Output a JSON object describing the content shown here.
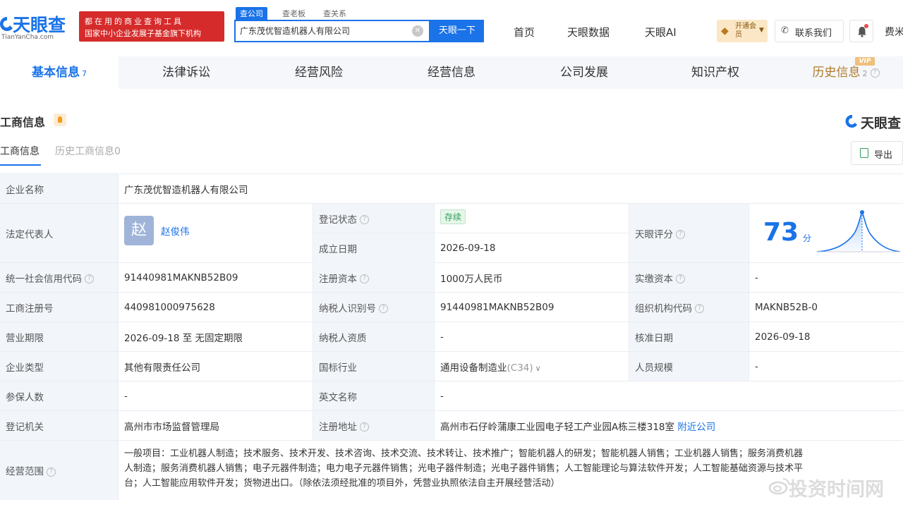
{
  "header": {
    "logo_text": "天眼查",
    "logo_sub": "TianYanCha.com",
    "promo_line1": "都在用的商业查询工具",
    "promo_line2": "国家中小企业发展子基金旗下机构",
    "search_tabs": [
      "查公司",
      "查老板",
      "查关系"
    ],
    "search_value": "广东茂优智造机器人有限公司",
    "search_button": "天眼一下",
    "nav": [
      "首页",
      "天眼数据",
      "天眼AI"
    ],
    "vip_label": "开通会员",
    "contact_label": "联系我们",
    "fee_label": "费米"
  },
  "module_tabs": [
    {
      "label": "基本信息",
      "count": "7",
      "active": true
    },
    {
      "label": "法律诉讼",
      "count": "",
      "active": false
    },
    {
      "label": "经营风险",
      "count": "",
      "active": false
    },
    {
      "label": "经营信息",
      "count": "",
      "active": false
    },
    {
      "label": "公司发展",
      "count": "",
      "active": false
    },
    {
      "label": "知识产权",
      "count": "",
      "active": false
    },
    {
      "label": "历史信息",
      "count": "2",
      "active": false
    }
  ],
  "vip_tag": "VIP",
  "section": {
    "title": "工商信息",
    "brand": "天眼查",
    "sub_tabs": [
      "工商信息",
      "历史工商信息0"
    ],
    "export_label": "导出"
  },
  "company": {
    "name_label": "企业名称",
    "name": "广东茂优智造机器人有限公司",
    "legal_rep_label": "法定代表人",
    "legal_rep_avatar": "赵",
    "legal_rep": "赵俊伟",
    "reg_status_label": "登记状态",
    "reg_status": "存续",
    "est_date_label": "成立日期",
    "est_date": "2026-09-18",
    "score_label": "天眼评分",
    "score": "73",
    "score_unit": "分",
    "credit_code_label": "统一社会信用代码",
    "credit_code": "91440981MAKNB52B09",
    "reg_capital_label": "注册资本",
    "reg_capital": "1000万人民币",
    "paid_capital_label": "实缴资本",
    "paid_capital": "-",
    "reg_no_label": "工商注册号",
    "reg_no": "440981000975628",
    "taxpayer_id_label": "纳税人识别号",
    "taxpayer_id": "91440981MAKNB52B09",
    "org_code_label": "组织机构代码",
    "org_code": "MAKNB52B-0",
    "term_label": "营业期限",
    "term": "2026-09-18 至 无固定期限",
    "taxpayer_qual_label": "纳税人资质",
    "taxpayer_qual": "-",
    "approval_date_label": "核准日期",
    "approval_date": "2026-09-18",
    "type_label": "企业类型",
    "type": "其他有限责任公司",
    "industry_label": "国标行业",
    "industry": "通用设备制造业",
    "industry_code": "(C34)",
    "staff_label": "人员规模",
    "staff": "-",
    "insured_label": "参保人数",
    "insured": "-",
    "en_name_label": "英文名称",
    "en_name": "-",
    "authority_label": "登记机关",
    "authority": "高州市市场监督管理局",
    "address_label": "注册地址",
    "address": "高州市石仔岭蒲康工业园电子轻工产业园A栋三楼318室",
    "nearby_label": "附近公司",
    "scope_label": "经营范围",
    "scope_line1": "一般项目：工业机器人制造；技术服务、技术开发、技术咨询、技术交流、技术转让、技术推广；智能机器人的研发；智能机器人销售；工业机器人销售；服务消费机器",
    "scope_line2": "人制造；服务消费机器人销售；电子元器件制造；电力电子元器件销售；光电子器件制造；光电子器件销售；人工智能理论与算法软件开发；人工智能基础资源与技术平",
    "scope_line3": "台；人工智能应用软件开发；货物进出口。（除依法须经批准的项目外，凭营业执照依法自主开展经营活动）"
  },
  "watermark": "投资时间网",
  "colors": {
    "brand_blue": "#1a73e8",
    "promo_red": "#d62b2b",
    "status_green": "#2e9c5a",
    "label_bg": "#f2f6fb"
  }
}
